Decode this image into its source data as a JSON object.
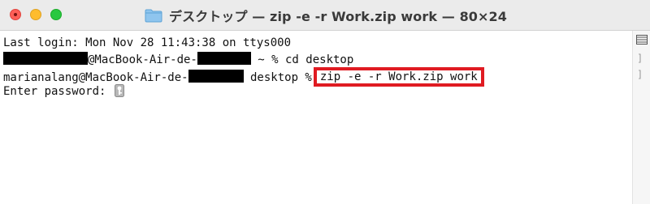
{
  "window": {
    "title": "デスクトップ — zip -e -r Work.zip work — 80×24"
  },
  "terminal": {
    "line1": "Last login: Mon Nov 28 11:43:38 on ttys000",
    "line2_host": "@MacBook-Air-de-",
    "line2_cmd": " ~ % cd desktop",
    "line3_user_host": "marianalang@MacBook-Air-de-",
    "line3_prompt": " desktop %",
    "line3_command": "zip -e -r Work.zip work",
    "line4": "Enter password: "
  },
  "colors": {
    "highlight_border": "#e01b22",
    "close": "#fe5f57",
    "minimize": "#febc2e",
    "maximize": "#28c840"
  },
  "icons": [
    "folder-icon",
    "key-icon",
    "split-pane-icon"
  ]
}
